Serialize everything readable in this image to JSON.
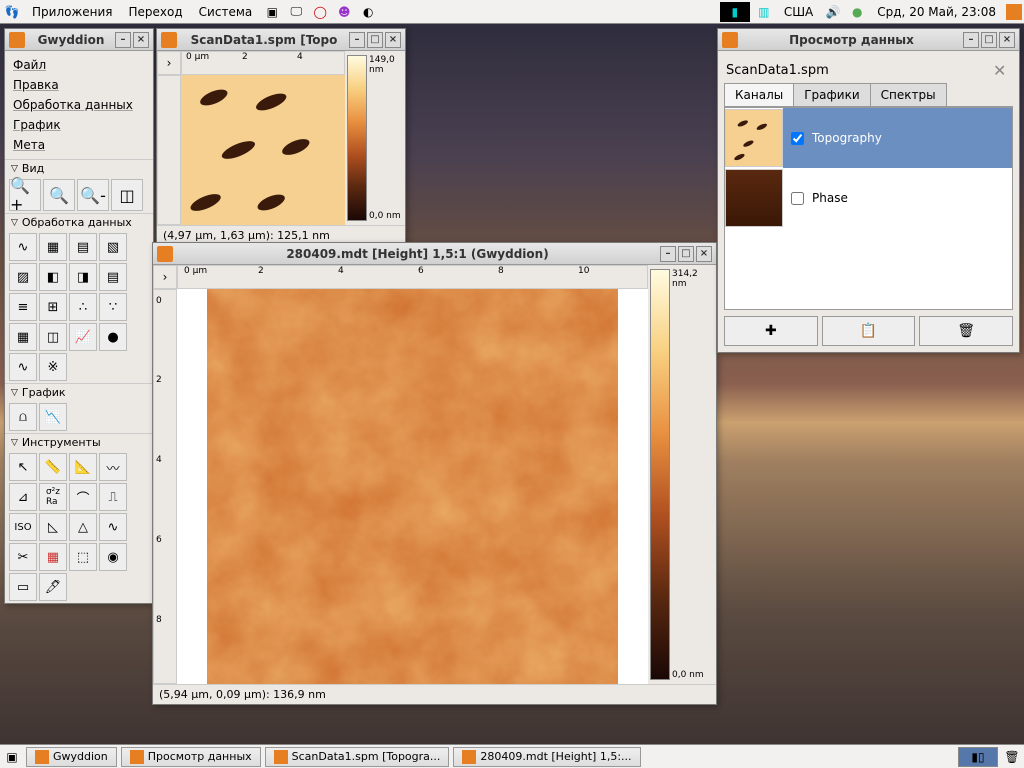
{
  "top_panel": {
    "menu": [
      "Приложения",
      "Переход",
      "Система"
    ],
    "lang": "США",
    "clock": "Срд, 20 Май, 23:08"
  },
  "toolbox": {
    "title": "Gwyddion",
    "menus": [
      "Файл",
      "Правка",
      "Обработка данных",
      "График",
      "Мета"
    ],
    "sect_view": "Вид",
    "sect_proc": "Обработка данных",
    "sect_graph": "График",
    "sect_tools": "Инструменты"
  },
  "win1": {
    "title": "ScanData1.spm [Topo",
    "scale_max": "149,0 nm",
    "scale_min": "0,0 nm",
    "status": "(4,97 µm, 1,63 µm): 125,1 nm",
    "x_ticks": [
      "0 µm",
      "2",
      "4"
    ]
  },
  "win2": {
    "title": "280409.mdt [Height] 1,5:1 (Gwyddion)",
    "scale_max": "314,2 nm",
    "scale_min": "0,0 nm",
    "status": "(5,94 µm, 0,09 µm): 136,9 nm",
    "x_ticks": [
      "0 µm",
      "2",
      "4",
      "6",
      "8",
      "10"
    ],
    "y_ticks": [
      "0",
      "2",
      "4",
      "6",
      "8"
    ]
  },
  "browser": {
    "title": "Просмотр данных",
    "file": "ScanData1.spm",
    "tabs": [
      "Каналы",
      "Графики",
      "Спектры"
    ],
    "channels": [
      {
        "label": "Topography",
        "checked": true
      },
      {
        "label": "Phase",
        "checked": false
      }
    ]
  },
  "taskbar": {
    "items": [
      "Gwyddion",
      "Просмотр данных",
      "ScanData1.spm [Topogra...",
      "280409.mdt [Height] 1,5:..."
    ]
  }
}
